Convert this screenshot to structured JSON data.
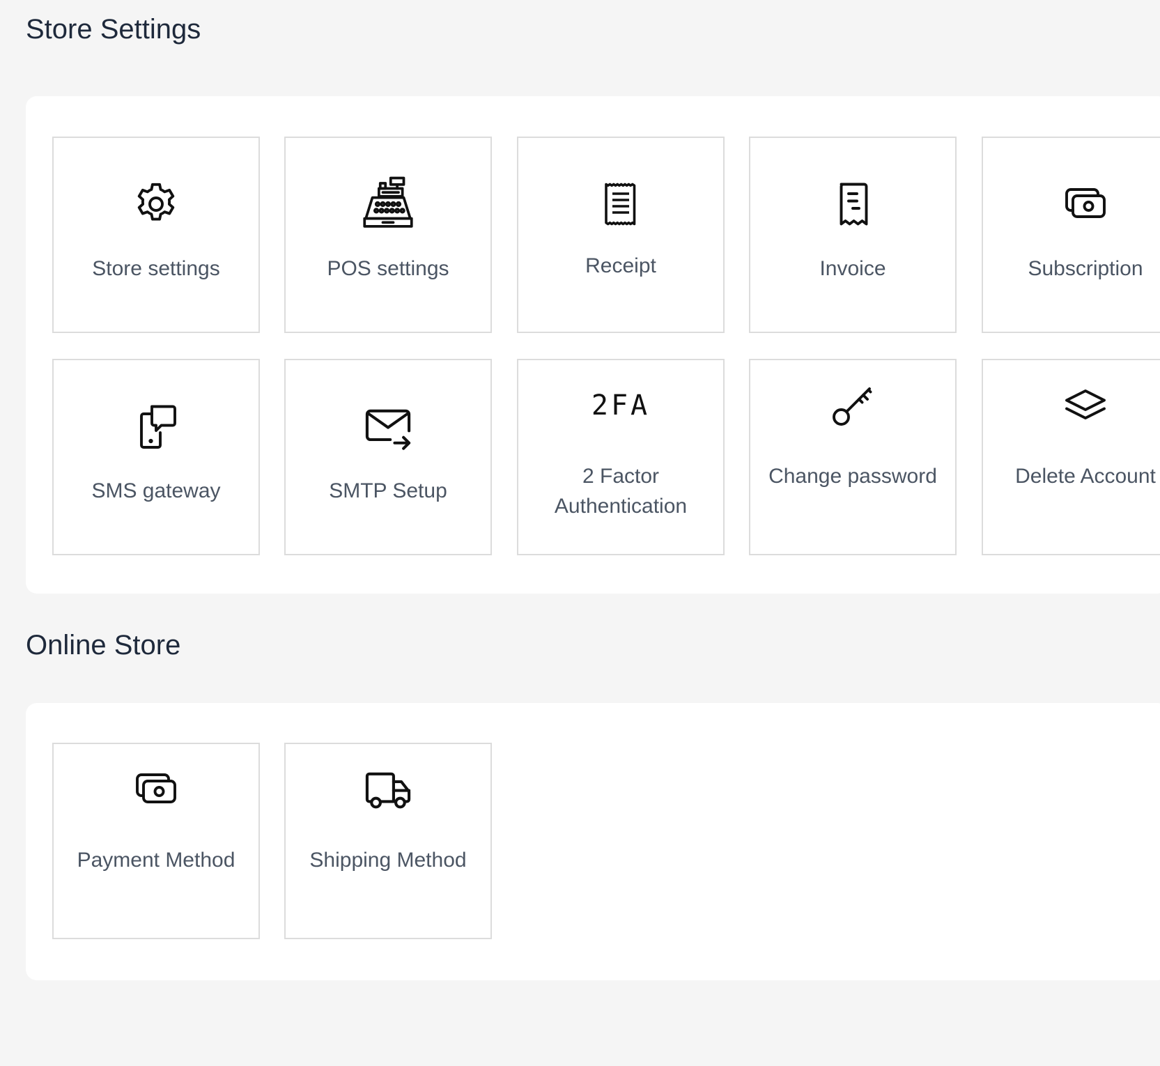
{
  "store_settings": {
    "title": "Store Settings",
    "tiles": [
      {
        "label": "Store settings",
        "icon": "gear-icon"
      },
      {
        "label": "POS settings",
        "icon": "cash-register-icon"
      },
      {
        "label": "Receipt",
        "icon": "receipt-icon"
      },
      {
        "label": "Invoice",
        "icon": "invoice-icon"
      },
      {
        "label": "Subscription",
        "icon": "cash-icon"
      },
      {
        "label": "SMS gateway",
        "icon": "sms-phone-icon"
      },
      {
        "label": "SMTP Setup",
        "icon": "mail-send-icon"
      },
      {
        "label": "2 Factor Authentication",
        "icon": "two-factor-icon",
        "icon_text": "2FA"
      },
      {
        "label": "Change password",
        "icon": "key-icon"
      },
      {
        "label": "Delete Account",
        "icon": "layers-icon"
      }
    ]
  },
  "online_store": {
    "title": "Online Store",
    "tiles": [
      {
        "label": "Payment Method",
        "icon": "cash-icon"
      },
      {
        "label": "Shipping Method",
        "icon": "truck-icon"
      }
    ]
  },
  "colors": {
    "background": "#f5f5f5",
    "panel": "#ffffff",
    "tile_border": "#dcdcdc",
    "title_text": "#1e293b",
    "label_text": "#4b5563",
    "icon_stroke": "#111111"
  }
}
